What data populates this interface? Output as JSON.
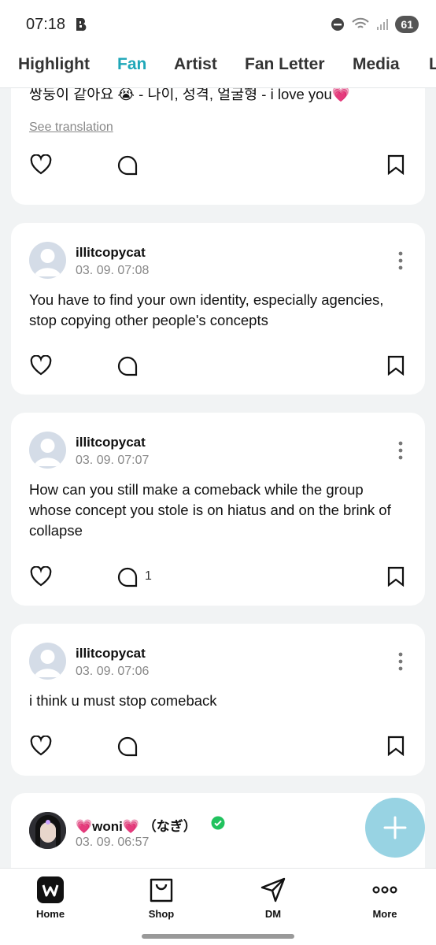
{
  "status_bar": {
    "time": "07:18",
    "battery": "61"
  },
  "tabs": [
    {
      "label": "Highlight"
    },
    {
      "label": "Fan"
    },
    {
      "label": "Artist"
    },
    {
      "label": "Fan Letter"
    },
    {
      "label": "Media"
    },
    {
      "label": "L"
    }
  ],
  "top_card": {
    "text": "쌍둥이 같아요 😭 - 나이, 성격, 얼굴형 - i love you💗",
    "see_translation": "See translation"
  },
  "posts": [
    {
      "author": "illitcopycat",
      "date": "03. 09. 07:08",
      "text": "You have to find your own identity, especially agencies, stop copying other people's concepts",
      "comment_count": ""
    },
    {
      "author": "illitcopycat",
      "date": "03. 09. 07:07",
      "text": "How can you still make a comeback while the group whose concept you stole is on hiatus and on the brink of collapse",
      "comment_count": "1"
    },
    {
      "author": "illitcopycat",
      "date": "03. 09. 07:06",
      "text": "i think u must stop comeback",
      "comment_count": ""
    }
  ],
  "last_post": {
    "author": "💗woni💗 （なぎ）",
    "date": "03. 09. 06:57"
  },
  "bottom_nav": [
    {
      "label": "Home"
    },
    {
      "label": "Shop"
    },
    {
      "label": "DM"
    },
    {
      "label": "More"
    }
  ]
}
